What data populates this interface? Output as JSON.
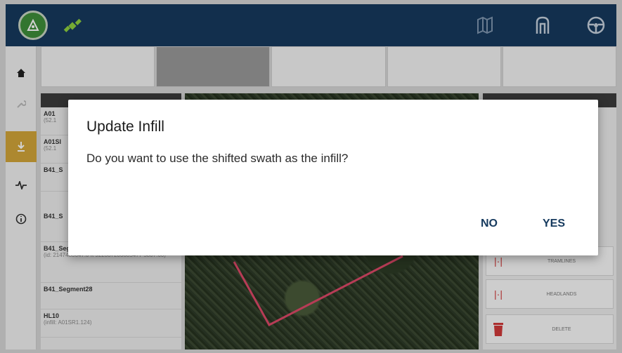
{
  "dialog": {
    "title": "Update Infill",
    "message": "Do you want to use the shifted swath as the infill?",
    "no_label": "NO",
    "yes_label": "YES"
  },
  "colors": {
    "topbar": "#163a5e",
    "accent_nav": "#d4a73a",
    "button_text": "#163a5e",
    "logo_green": "#3f8f3a"
  },
  "topbar": {
    "icons": [
      "logo-icon",
      "satellite-icon",
      "map-icon",
      "implement-icon",
      "steering-wheel-icon"
    ]
  },
  "leftnav": {
    "icons": [
      "home-icon",
      "wrench-icon",
      "download-icon",
      "pulse-icon",
      "info-icon"
    ]
  },
  "list": {
    "items": [
      {
        "name": "A01",
        "sub": "(52.1"
      },
      {
        "name": "A01SI",
        "sub": "(52.1"
      },
      {
        "name": "B41_S",
        "sub": ""
      },
      {
        "name": "B41_S",
        "sub": ""
      },
      {
        "name": "B41_Segment27",
        "sub": "(id: 2147483647.0 ft 922337203685477 5807.60)"
      },
      {
        "name": "B41_Segment28",
        "sub": ""
      },
      {
        "name": "HL10",
        "sub": "(infill: A01SR1.124)"
      }
    ]
  },
  "rightpanel": {
    "buttons": [
      "TRAMLINES",
      "HEADLANDS",
      "DELETE"
    ]
  }
}
